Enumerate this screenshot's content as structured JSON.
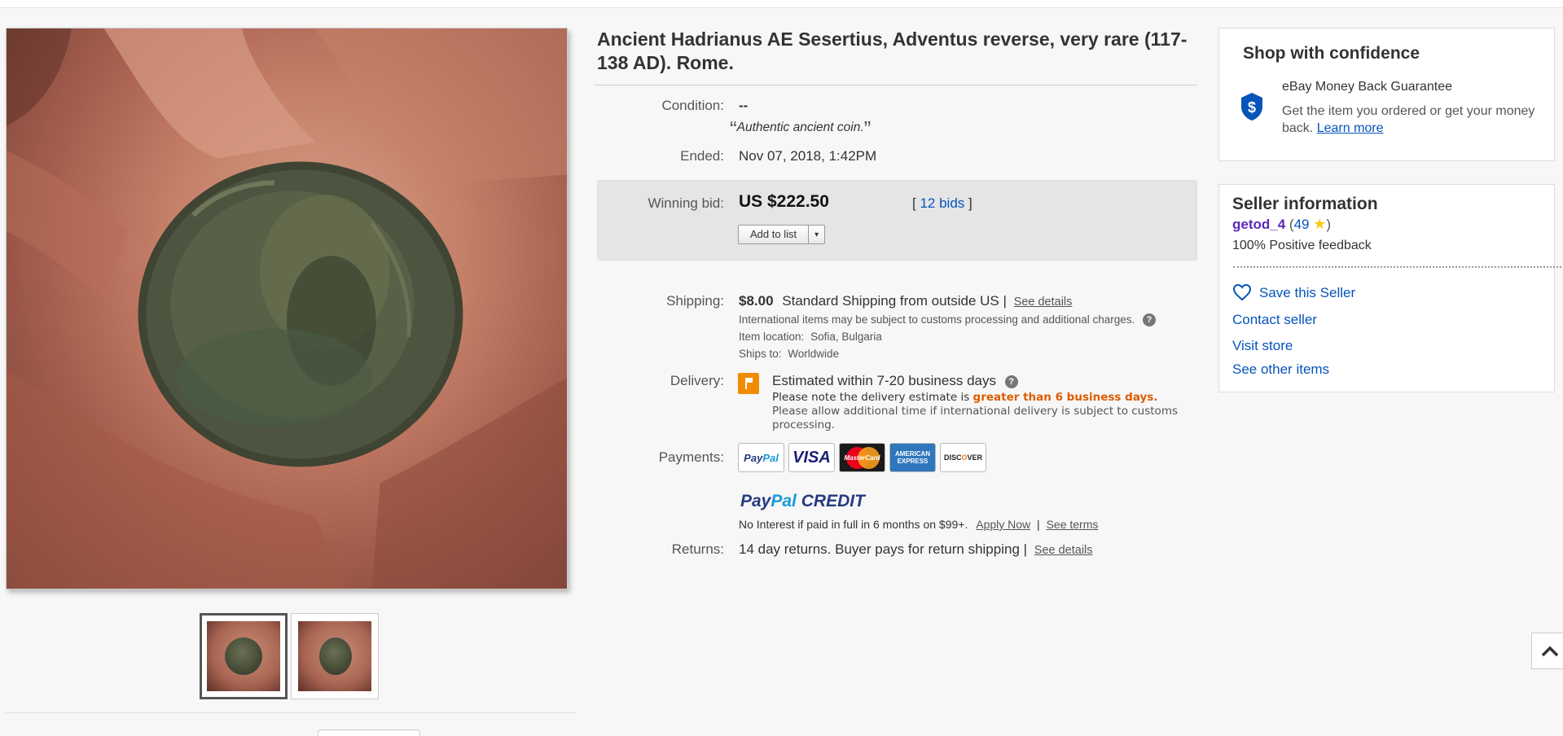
{
  "listing": {
    "title": "Ancient Hadrianus AE Sesertius, Adventus reverse, very rare (117-138 AD). Rome."
  },
  "condition": {
    "label": "Condition:",
    "value": "--",
    "quote": "Authentic ancient coin.",
    "quote_open": "“",
    "quote_close": "”"
  },
  "ended": {
    "label": "Ended:",
    "value": "Nov 07, 2018, 1:42PM"
  },
  "bid": {
    "label": "Winning bid:",
    "amount": "US $222.50",
    "bids_open": "[",
    "bids_link": "12 bids",
    "bids_close": "]",
    "add_to_list": "Add to list",
    "caret": "▾"
  },
  "shipping": {
    "label": "Shipping:",
    "cost": "$8.00",
    "method": "Standard Shipping from outside US |",
    "details_link": "See details",
    "customs_note": "International items may be subject to customs processing and additional charges.",
    "location_label": "Item location:",
    "location": "Sofia, Bulgaria",
    "ships_to_label": "Ships to:",
    "ships_to": "Worldwide"
  },
  "delivery": {
    "label": "Delivery:",
    "estimate": "Estimated within 7-20 business days",
    "note_prefix": "Please note the delivery estimate is",
    "note_highlight": "greater than 6 business days.",
    "note_extra": "Please allow additional time if international delivery is subject to customs processing."
  },
  "payments": {
    "label": "Payments:",
    "logos": {
      "paypal_a": "Pay",
      "paypal_b": "Pal",
      "visa": "VISA",
      "mastercard": "MasterCard",
      "amex_1": "AMERICAN",
      "amex_2": "EXPRESS",
      "discover_a": "DISC",
      "discover_b": "O",
      "discover_c": "VER"
    },
    "credit_a": "Pay",
    "credit_b": "Pal",
    "credit_c": "CREDIT",
    "credit_note": "No Interest if paid in full in 6 months on $99+.",
    "apply_link": "Apply Now",
    "sep": "|",
    "terms_link": "See terms"
  },
  "returns": {
    "label": "Returns:",
    "value": "14 day returns. Buyer pays for return shipping |",
    "details_link": "See details"
  },
  "confidence": {
    "title": "Shop with confidence",
    "guarantee_title": "eBay Money Back Guarantee",
    "guarantee_text": "Get the item you ordered or get your money back.",
    "learn_more": "Learn more"
  },
  "seller": {
    "title": "Seller information",
    "name": "getod_4",
    "score_open": "(",
    "score": "49",
    "score_close": ")",
    "feedback": "100% Positive feedback",
    "save": "Save this Seller",
    "contact": "Contact seller",
    "store": "Visit store",
    "other_items": "See other items"
  },
  "icons": {
    "help": "?",
    "star": "★",
    "scroll_top": "chevron-up-icon"
  },
  "colors": {
    "link_blue": "#0654ba",
    "seller_purple": "#5d28b8",
    "warning_orange": "#dd5c00",
    "flag_orange": "#f18c00"
  }
}
